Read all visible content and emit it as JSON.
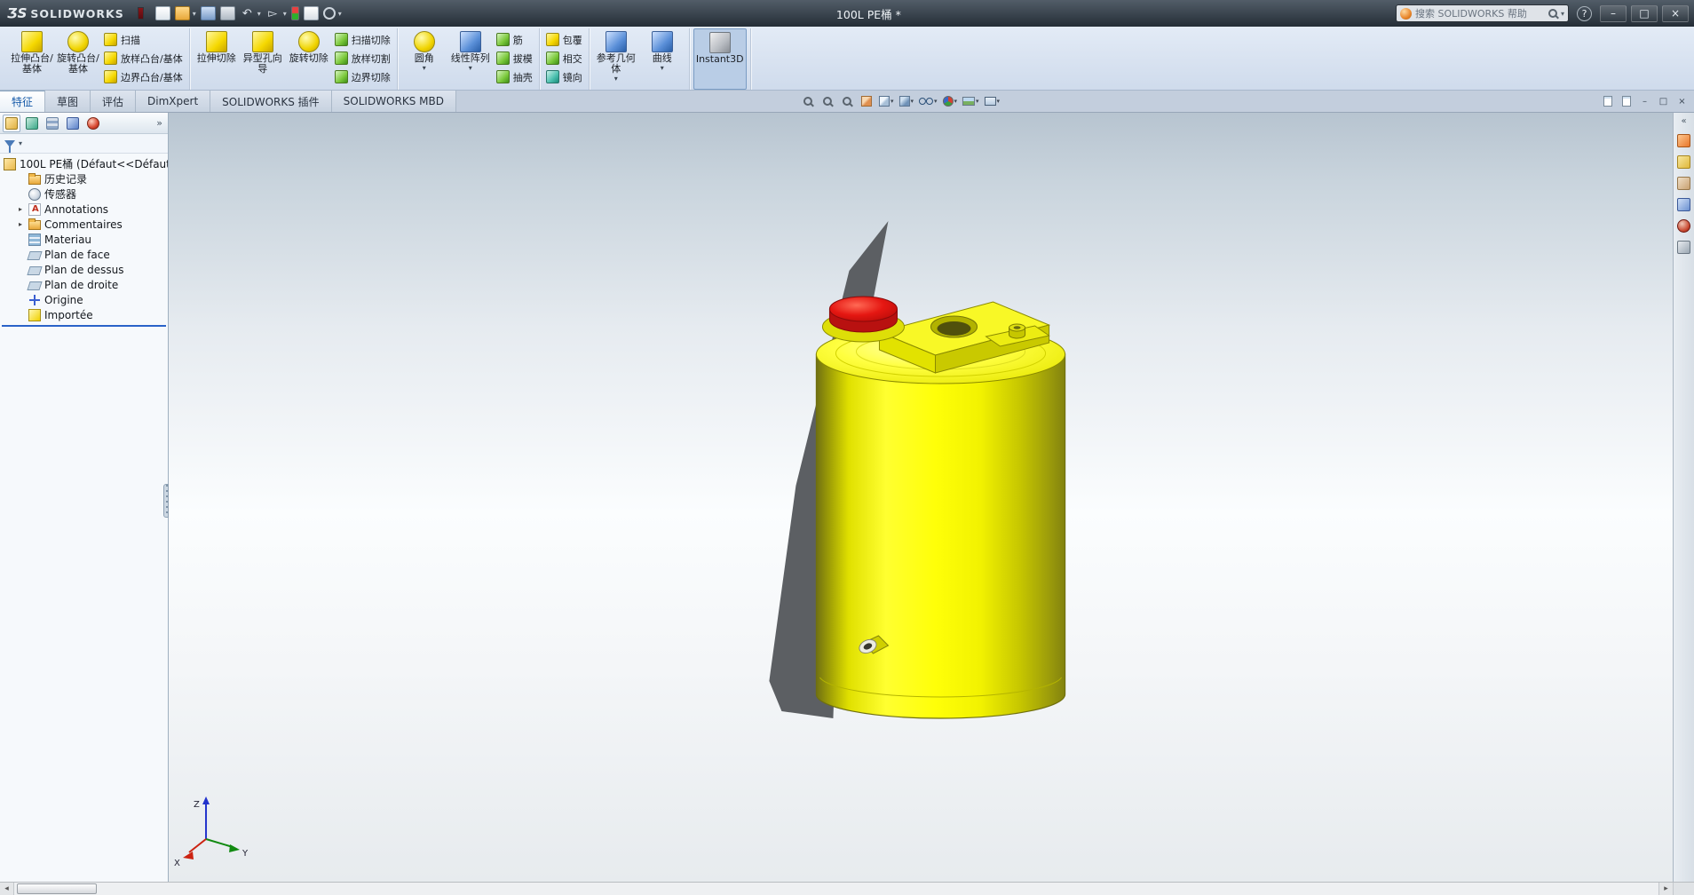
{
  "glyphs": {
    "caret": "▾",
    "overflow": "»",
    "collapse": "«",
    "minimize": "–",
    "restore": "□",
    "close": "×",
    "help": "?",
    "scroll_left": "◂",
    "scroll_right": "▸",
    "expand": "▸",
    "undo": "↶",
    "select_arrow": "▻"
  },
  "title_bar": {
    "logo_ds": "ƷS",
    "logo_text": "SOLIDWORKS",
    "document_title": "100L PE桶 *",
    "search_placeholder": "搜索 SOLIDWORKS 帮助"
  },
  "quick_access": [
    "new-document",
    "open",
    "save",
    "print",
    "undo",
    "select",
    "rebuild",
    "file-properties",
    "options"
  ],
  "ribbon": {
    "buttons": [
      "拉伸凸台/基体",
      "旋转凸台/基体",
      "扫描",
      "放样凸台/基体",
      "边界凸台/基体",
      "拉伸切除",
      "异型孔向导",
      "旋转切除",
      "扫描切除",
      "放样切割",
      "边界切除",
      "圆角",
      "线性阵列",
      "筋",
      "拔模",
      "抽壳",
      "包覆",
      "相交",
      "镜向",
      "参考几何体",
      "曲线",
      "Instant3D"
    ]
  },
  "tabs": [
    "特征",
    "草图",
    "评估",
    "DimXpert",
    "SOLIDWORKS 插件",
    "SOLIDWORKS MBD"
  ],
  "viewbar_icons": [
    "zoom-to-fit",
    "zoom-to-area",
    "previous-view",
    "section-view",
    "view-orientation",
    "display-style",
    "hide-show-items",
    "edit-appearance",
    "apply-scene",
    "view-settings"
  ],
  "feature_tree": {
    "root_label": "100L PE桶  (Défaut<<Défaut",
    "items": [
      "历史记录",
      "传感器",
      "Annotations",
      "Commentaires",
      "Materiau",
      "Plan de face",
      "Plan de dessus",
      "Plan de droite",
      "Origine",
      "Importée"
    ],
    "expandable_items": [
      "Annotations",
      "Commentaires"
    ]
  },
  "viewport": {
    "triad": {
      "x": "X",
      "y": "Y",
      "z": "Z"
    },
    "model": {
      "name": "100L PE桶",
      "body_color": "#f2e400",
      "cap_color": "#d51414",
      "shadow_color": "#5c5f63",
      "background_top": "#b7c4d0",
      "background_mid": "#fbfdfe"
    }
  },
  "task_pane_icons": [
    "solidworks-resources",
    "design-library",
    "file-explorer",
    "view-palette",
    "appearances",
    "custom-properties"
  ]
}
